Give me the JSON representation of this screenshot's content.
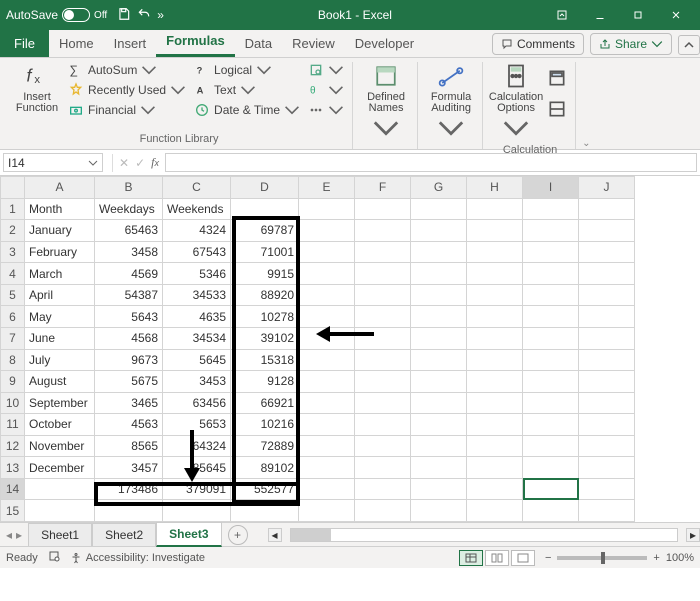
{
  "titlebar": {
    "autosave": "AutoSave",
    "autosave_state": "Off",
    "title": "Book1 - Excel"
  },
  "tabs": {
    "file": "File",
    "home": "Home",
    "insert": "Insert",
    "formulas": "Formulas",
    "data": "Data",
    "review": "Review",
    "developer": "Developer",
    "comments": "Comments",
    "share": "Share"
  },
  "ribbon": {
    "insert_function": "Insert\nFunction",
    "autosum": "AutoSum",
    "recently": "Recently Used",
    "financial": "Financial",
    "logical": "Logical",
    "text": "Text",
    "datetime": "Date & Time",
    "group_library": "Function Library",
    "defined_names": "Defined\nNames",
    "formula_auditing": "Formula\nAuditing",
    "calc_options": "Calculation\nOptions",
    "group_calc": "Calculation"
  },
  "namebox": "I14",
  "columns": [
    "A",
    "B",
    "C",
    "D",
    "E",
    "F",
    "G",
    "H",
    "I",
    "J"
  ],
  "headers": {
    "a": "Month",
    "b": "Weekdays",
    "c": "Weekends"
  },
  "rows": [
    {
      "a": "January",
      "b": 65463,
      "c": 4324,
      "d": 69787
    },
    {
      "a": "February",
      "b": 3458,
      "c": 67543,
      "d": 71001
    },
    {
      "a": "March",
      "b": 4569,
      "c": 5346,
      "d": 9915
    },
    {
      "a": "April",
      "b": 54387,
      "c": 34533,
      "d": 88920
    },
    {
      "a": "May",
      "b": 5643,
      "c": 4635,
      "d": 10278
    },
    {
      "a": "June",
      "b": 4568,
      "c": 34534,
      "d": 39102
    },
    {
      "a": "July",
      "b": 9673,
      "c": 5645,
      "d": 15318
    },
    {
      "a": "August",
      "b": 5675,
      "c": 3453,
      "d": 9128
    },
    {
      "a": "September",
      "b": 3465,
      "c": 63456,
      "d": 66921
    },
    {
      "a": "October",
      "b": 4563,
      "c": 5653,
      "d": 10216
    },
    {
      "a": "November",
      "b": 8565,
      "c": 64324,
      "d": 72889
    },
    {
      "a": "December",
      "b": 3457,
      "c": 85645,
      "d": 89102
    }
  ],
  "totals": {
    "b": 173486,
    "c": 379091,
    "d": 552577
  },
  "sheets": {
    "s1": "Sheet1",
    "s2": "Sheet2",
    "s3": "Sheet3"
  },
  "status": {
    "ready": "Ready",
    "acc": "Accessibility: Investigate",
    "zoom": "100%"
  }
}
